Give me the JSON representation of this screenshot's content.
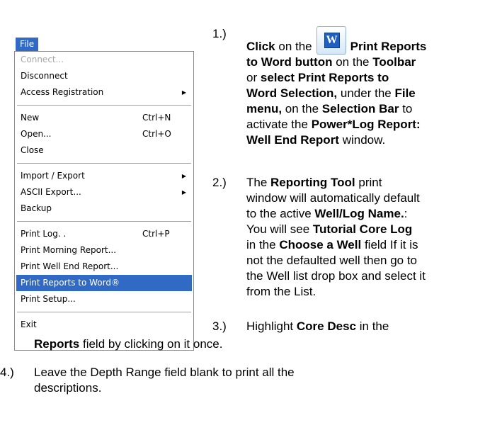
{
  "menu": {
    "title": "File",
    "groups": [
      [
        {
          "label": "Connect...",
          "disabled": true
        },
        {
          "label": "Disconnect"
        },
        {
          "label": "Access Registration",
          "submenu": true
        }
      ],
      [
        {
          "label": "New",
          "shortcut": "Ctrl+N"
        },
        {
          "label": "Open...",
          "shortcut": "Ctrl+O"
        },
        {
          "label": "Close"
        }
      ],
      [
        {
          "label": "Import / Export",
          "submenu": true
        },
        {
          "label": "ASCII Export...",
          "submenu": true
        },
        {
          "label": "Backup"
        }
      ],
      [
        {
          "label": "Print Log. .",
          "shortcut": "Ctrl+P"
        },
        {
          "label": "Print Morning Report..."
        },
        {
          "label": "Print Well End Report..."
        },
        {
          "label": "Print Reports to Word®",
          "selected": true
        },
        {
          "label": "Print Setup..."
        }
      ],
      [
        {
          "label": "Exit"
        }
      ]
    ]
  },
  "icons": {
    "word_button": "word-toolbar-icon",
    "submenu_arrow": "submenu-arrow-icon"
  },
  "steps": {
    "s1": {
      "num": "1.)",
      "click": "Click",
      "on_the": "on the",
      "print_reports": "Print Reports",
      "to_word_button": "to Word button",
      "on_the2": "on the",
      "toolbar": "Toolbar",
      "or": "or",
      "select_print": "select  Print Reports to",
      "word_selection": "Word Selection,",
      "under_the": "under the",
      "file": "File",
      "menu": "menu,",
      "on_the3": "on the",
      "selection_bar": "Selection Bar",
      "to": "to",
      "activate_the": "activate the",
      "power_log": "Power*Log Report:",
      "well_end": "Well End Report",
      "window": "window."
    },
    "s2": {
      "num": "2.)",
      "the": "The",
      "reporting_tool": "Reporting Tool",
      "print": "print",
      "l2": "window will automatically default",
      "to_the_active": "to the active",
      "well_log": "Well/Log Name.",
      "colon": ":",
      "you_will_see": "You will see",
      "tutorial": "Tutorial Core Log",
      "in_the": "in the",
      "choose": "Choose a Well",
      "field_if": "field If it is",
      "l6": "not the defaulted well then go to",
      "l7": "the Well list drop box and select it",
      "l8": "from the List."
    },
    "s3": {
      "num": "3.)",
      "highlight": "Highlight",
      "core_desc": "Core Desc",
      "in_the": "in the",
      "reports": "Reports",
      "rest": "field by clicking on it once."
    },
    "s4": {
      "num": "4.)",
      "l1": "Leave the Depth Range field blank to print all the",
      "l2": "descriptions."
    }
  }
}
